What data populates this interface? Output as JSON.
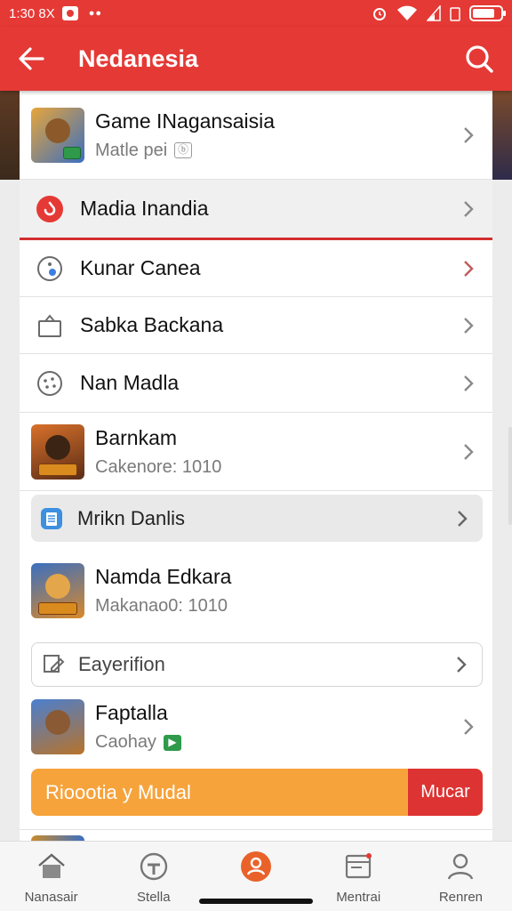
{
  "status_bar": {
    "time": "1:30 8X"
  },
  "app_bar": {
    "title": "Nedanesia"
  },
  "list": {
    "rows": [
      {
        "title": "Game INagansaisia",
        "subtitle": "Matle pei",
        "badge": "ⓑ"
      },
      {
        "title": "Madia Inandia"
      },
      {
        "title": "Kunar Canea"
      },
      {
        "title": "Sabka Backana"
      },
      {
        "title": "Nan Madla"
      },
      {
        "title": "Barnkam",
        "subtitle": "Cakenore: 1010"
      },
      {
        "title": "Mrikn Danlis"
      },
      {
        "title": "Namda Edkara",
        "subtitle": "Makanao0: 1010"
      },
      {
        "title": "Eayerifion"
      },
      {
        "title": "Faptalla",
        "subtitle": "Caohay",
        "badge": "▶"
      }
    ],
    "action_bar": {
      "label": "Rioootia y Mudal",
      "button": "Mucar"
    }
  },
  "bottom_nav": [
    {
      "label": "Nanasair",
      "icon": "home-icon"
    },
    {
      "label": "Stella",
      "icon": "shield-icon"
    },
    {
      "label": "",
      "icon": "profile-badge-icon"
    },
    {
      "label": "Mentrai",
      "icon": "inbox-icon"
    },
    {
      "label": "Renren",
      "icon": "person-icon"
    }
  ],
  "colors": {
    "primary": "#e53935",
    "accent": "#f6a33b",
    "danger": "#dd3333"
  }
}
